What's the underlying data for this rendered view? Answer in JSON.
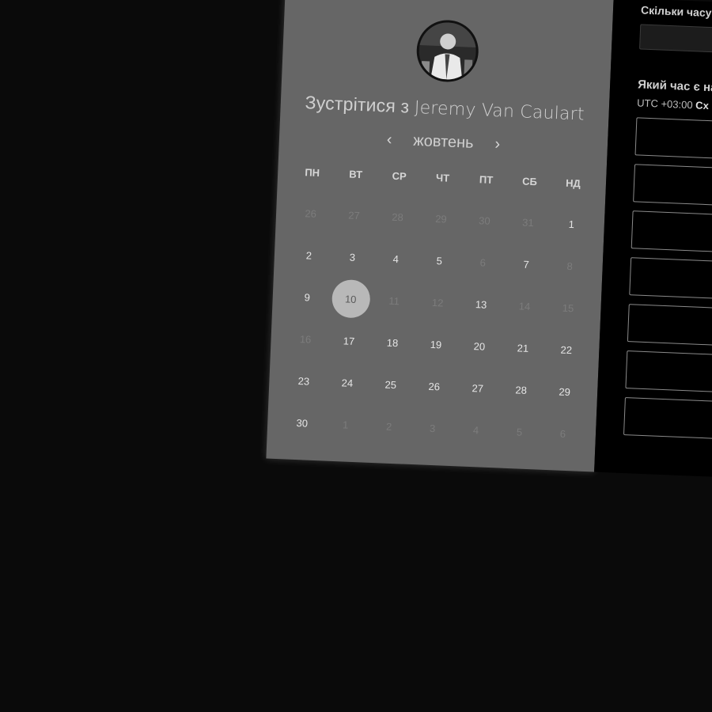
{
  "booking": {
    "title_prefix": "Зустрітися з",
    "host_name": "Jeremy Van Caulart",
    "avatar_icon": "host-avatar-photo"
  },
  "calendar": {
    "prev_icon": "‹",
    "next_icon": "›",
    "month": "жовтень",
    "weekdays": [
      "ПН",
      "ВТ",
      "СР",
      "ЧТ",
      "ПТ",
      "СБ",
      "НД"
    ],
    "days": [
      {
        "label": "26",
        "muted": true
      },
      {
        "label": "27",
        "muted": true
      },
      {
        "label": "28",
        "muted": true
      },
      {
        "label": "29",
        "muted": true
      },
      {
        "label": "30",
        "muted": true
      },
      {
        "label": "31",
        "muted": true
      },
      {
        "label": "1",
        "muted": false
      },
      {
        "label": "2",
        "muted": false
      },
      {
        "label": "3",
        "muted": false
      },
      {
        "label": "4",
        "muted": false
      },
      {
        "label": "5",
        "muted": false
      },
      {
        "label": "6",
        "muted": true
      },
      {
        "label": "7",
        "muted": false
      },
      {
        "label": "8",
        "muted": true
      },
      {
        "label": "9",
        "muted": false
      },
      {
        "label": "10",
        "muted": false,
        "selected": true
      },
      {
        "label": "11",
        "muted": true
      },
      {
        "label": "12",
        "muted": true
      },
      {
        "label": "13",
        "muted": false
      },
      {
        "label": "14",
        "muted": true
      },
      {
        "label": "15",
        "muted": true
      },
      {
        "label": "16",
        "muted": true
      },
      {
        "label": "17",
        "muted": false
      },
      {
        "label": "18",
        "muted": false
      },
      {
        "label": "19",
        "muted": false
      },
      {
        "label": "20",
        "muted": false
      },
      {
        "label": "21",
        "muted": false
      },
      {
        "label": "22",
        "muted": false
      },
      {
        "label": "23",
        "muted": false
      },
      {
        "label": "24",
        "muted": false
      },
      {
        "label": "25",
        "muted": false
      },
      {
        "label": "26",
        "muted": false
      },
      {
        "label": "27",
        "muted": false
      },
      {
        "label": "28",
        "muted": false
      },
      {
        "label": "29",
        "muted": false
      },
      {
        "label": "30",
        "muted": false
      },
      {
        "label": "1",
        "muted": true
      },
      {
        "label": "2",
        "muted": true
      },
      {
        "label": "3",
        "muted": true
      },
      {
        "label": "4",
        "muted": true
      },
      {
        "label": "5",
        "muted": true
      },
      {
        "label": "6",
        "muted": true
      }
    ]
  },
  "form": {
    "duration_question": "Скільки часу",
    "time_question": "Який час є на",
    "timezone_offset": "UTC +03:00",
    "timezone_name": "Сх",
    "slot_count": 7
  },
  "colors": {
    "card_bg": "#666666",
    "page_bg": "#0a0a0a",
    "selected_day_bg": "#b8b8b8"
  }
}
